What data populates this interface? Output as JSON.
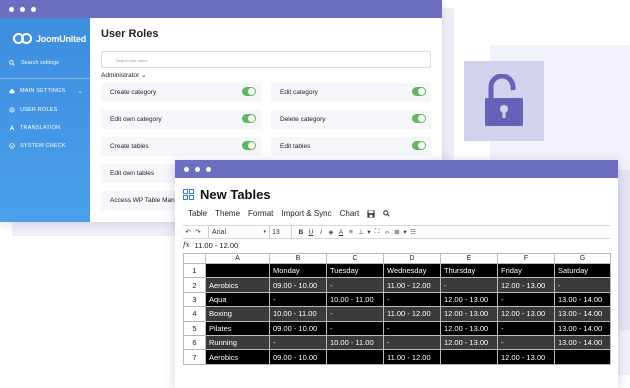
{
  "colors": {
    "accent": "#6c6fbf",
    "sidebar": "#4296e4",
    "toggle_on": "#5fb85f",
    "lock": "#6562b8"
  },
  "back_window": {
    "logo": "JoomUnited",
    "sidebar": {
      "search_label": "Search settings",
      "items": [
        {
          "label": "MAIN SETTINGS",
          "icon": "home-icon"
        },
        {
          "label": "USER ROLES",
          "icon": "gear-icon"
        },
        {
          "label": "TRANSLATION",
          "icon": "translate-icon"
        },
        {
          "label": "SYSTEM CHECK",
          "icon": "check-icon"
        }
      ]
    },
    "title": "User Roles",
    "search_placeholder": "Search role name",
    "role_select": "Administrator",
    "permissions": [
      {
        "label": "Create category",
        "enabled": true
      },
      {
        "label": "Edit category",
        "enabled": true
      },
      {
        "label": "Edit own category",
        "enabled": true
      },
      {
        "label": "Delete category",
        "enabled": true
      },
      {
        "label": "Create tables",
        "enabled": true
      },
      {
        "label": "Edit tables",
        "enabled": true
      },
      {
        "label": "Edit own tables",
        "enabled": true
      },
      {
        "label": "Access WP Table Manager",
        "enabled": true
      }
    ]
  },
  "lock_icon": "unlock-icon",
  "front_window": {
    "title": "New Tables",
    "menu": [
      "Table",
      "Theme",
      "Format",
      "Import & Sync",
      "Chart"
    ],
    "toolbar": {
      "font": "Arial",
      "size": "13"
    },
    "formula": {
      "label": "fx",
      "value": "11.00 - 12.00"
    },
    "columns": [
      "A",
      "B",
      "C",
      "D",
      "E",
      "F",
      "G"
    ],
    "rows": [
      {
        "n": "1",
        "cells": [
          "",
          "Monday",
          "Tuesday",
          "Wednesday",
          "Thursday",
          "Friday",
          "Saturday"
        ]
      },
      {
        "n": "2",
        "cells": [
          "Aerobics",
          "09.00 - 10.00",
          "-",
          "11.00 - 12.00",
          "-",
          "12.00 - 13.00",
          "-"
        ]
      },
      {
        "n": "3",
        "cells": [
          "Aqua",
          "-",
          "10.00 - 11.00",
          "-",
          "12.00 - 13.00",
          "-",
          "13.00 - 14.00"
        ]
      },
      {
        "n": "4",
        "cells": [
          "Boxing",
          "10.00 - 11.00",
          "-",
          "11.00 - 12.00",
          "12.00 - 13.00",
          "12.00 - 13.00",
          "13.00 - 14.00"
        ]
      },
      {
        "n": "5",
        "cells": [
          "Pilates",
          "09.00 - 10.00",
          "-",
          "-",
          "12.00 - 13.00",
          "-",
          "13.00 - 14.00"
        ]
      },
      {
        "n": "6",
        "cells": [
          "Running",
          "-",
          "10.00 - 11.00",
          "-",
          "12.00 - 13.00",
          "-",
          "13.00 - 14.00"
        ]
      },
      {
        "n": "7",
        "cells": [
          "Aerobics",
          "09.00 - 10.00",
          "",
          "11.00 - 12.00",
          "",
          "12.00 - 13.00",
          ""
        ]
      }
    ]
  }
}
